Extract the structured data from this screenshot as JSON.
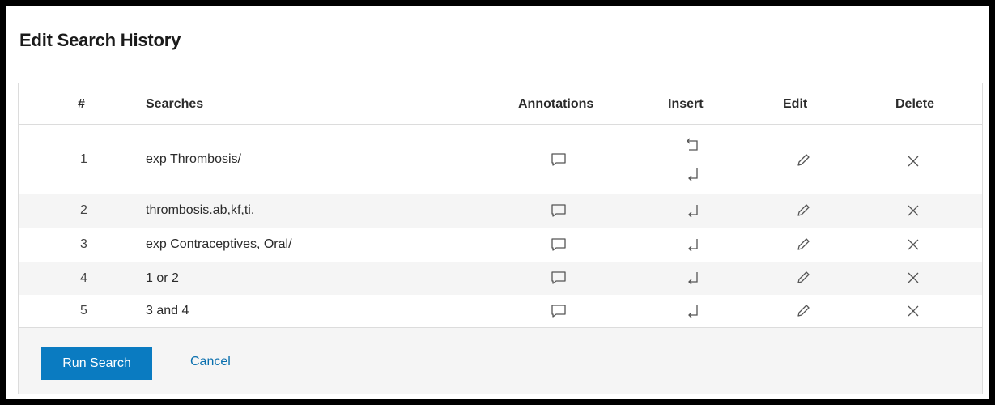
{
  "dialog": {
    "title": "Edit Search History"
  },
  "table": {
    "headers": {
      "num": "#",
      "searches": "Searches",
      "annotations": "Annotations",
      "insert": "Insert",
      "edit": "Edit",
      "delete": "Delete"
    },
    "rows": [
      {
        "num": "1",
        "search": "exp Thrombosis/",
        "insert_icons": [
          "insert-above-icon",
          "insert-below-icon"
        ]
      },
      {
        "num": "2",
        "search": "thrombosis.ab,kf,ti.",
        "insert_icons": [
          "insert-below-icon"
        ]
      },
      {
        "num": "3",
        "search": "exp Contraceptives, Oral/",
        "insert_icons": [
          "insert-below-icon"
        ]
      },
      {
        "num": "4",
        "search": "1 or 2",
        "insert_icons": [
          "insert-below-icon"
        ]
      },
      {
        "num": "5",
        "search": "3 and 4",
        "insert_icons": [
          "insert-below-icon"
        ]
      }
    ],
    "row_icons": {
      "annotation": "comment-icon",
      "edit": "pencil-icon",
      "delete": "close-icon"
    }
  },
  "footer": {
    "run_label": "Run Search",
    "cancel_label": "Cancel"
  },
  "colors": {
    "primary": "#0a7bc1",
    "link": "#0a6fae",
    "row_alt": "#f5f5f5",
    "border": "#dcdcdc"
  }
}
